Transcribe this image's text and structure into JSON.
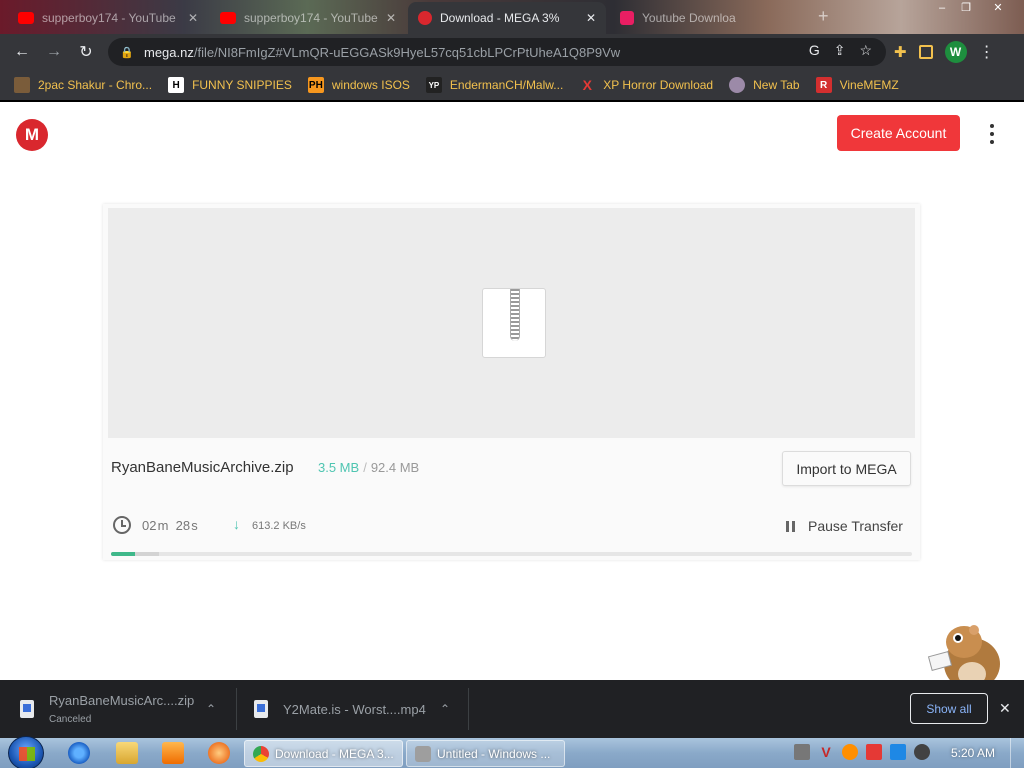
{
  "browser": {
    "tabs": [
      {
        "title": "supperboy174 - YouTube",
        "active": false
      },
      {
        "title": "supperboy174 - YouTube",
        "active": false
      },
      {
        "title": "Download - MEGA 3%",
        "active": true
      },
      {
        "title": "Youtube Downloa",
        "active": false
      }
    ],
    "url_host": "mega.nz",
    "url_path": "/file/NI8FmIgZ#VLmQR-uEGGASk9HyeL57cq51cbLPCrPtUheA1Q8P9Vw",
    "profile_initial": "W",
    "bookmarks": [
      {
        "label": "2pac Shakur - Chro...",
        "icon": "pile-icon"
      },
      {
        "label": "FUNNY SNIPPIES",
        "icon": "H"
      },
      {
        "label": "windows ISOS",
        "icon": "PH"
      },
      {
        "label": "EndermanCH/Malw...",
        "icon": "YP"
      },
      {
        "label": "XP Horror Download",
        "icon": "X"
      },
      {
        "label": "New Tab",
        "icon": "globe-icon"
      },
      {
        "label": "VineMEMZ",
        "icon": "R"
      }
    ]
  },
  "page": {
    "logo": "M",
    "create_account": "Create Account",
    "file": {
      "name": "RyanBaneMusicArchive.zip",
      "downloaded": "3.5 MB",
      "separator": "/",
      "total": "92.4 MB",
      "import_label": "Import to MEGA",
      "time_min": "02",
      "time_min_unit": "m",
      "time_sec": "28",
      "time_sec_unit": "s",
      "speed": "613.2 KB/s",
      "pause_label": "Pause Transfer",
      "progress_fraction": 0.03
    }
  },
  "shelf": {
    "items": [
      {
        "name": "RyanBaneMusicArc....zip",
        "status": "Canceled"
      },
      {
        "name": "Y2Mate.is - Worst....mp4",
        "status": ""
      }
    ],
    "show_all": "Show all"
  },
  "taskbar": {
    "windows": [
      {
        "title": "Download - MEGA 3..."
      },
      {
        "title": "Untitled - Windows ..."
      }
    ],
    "clock": "5:20 AM"
  },
  "colors": {
    "mega_red": "#d9272e",
    "create_button": "#f0373a",
    "progress": "#3fb88a",
    "downloaded_text": "#4ec5b1",
    "bookmark_text": "#f2c14e"
  }
}
